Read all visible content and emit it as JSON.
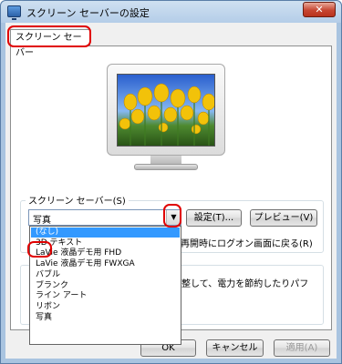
{
  "window": {
    "title": "スクリーン セーバーの設定",
    "close_glyph": "✕"
  },
  "tab": {
    "label": "スクリーン セーバー"
  },
  "group": {
    "label": "スクリーン セーバー(S)"
  },
  "combo": {
    "value": "写真",
    "arrow_glyph": "▼"
  },
  "buttons": {
    "settings": "設定(T)...",
    "preview": "プレビュー(V)",
    "ok": "OK",
    "cancel": "キャンセル",
    "apply": "適用(A)"
  },
  "resume_text": "再開時にログオン画面に戻る(R)",
  "power_text": "整して、電力を節約したりパフ",
  "dropdown": {
    "selected_index": 0,
    "items": [
      "(なし)",
      "3D テキスト",
      "LaVie 液晶デモ用 FHD",
      "LaVie 液晶デモ用 FWXGA",
      "バブル",
      "ブランク",
      "ライン アート",
      "リボン",
      "写真"
    ]
  },
  "colors": {
    "selection": "#3399ff",
    "highlight": "#e00000",
    "close_button": "#c74632"
  }
}
